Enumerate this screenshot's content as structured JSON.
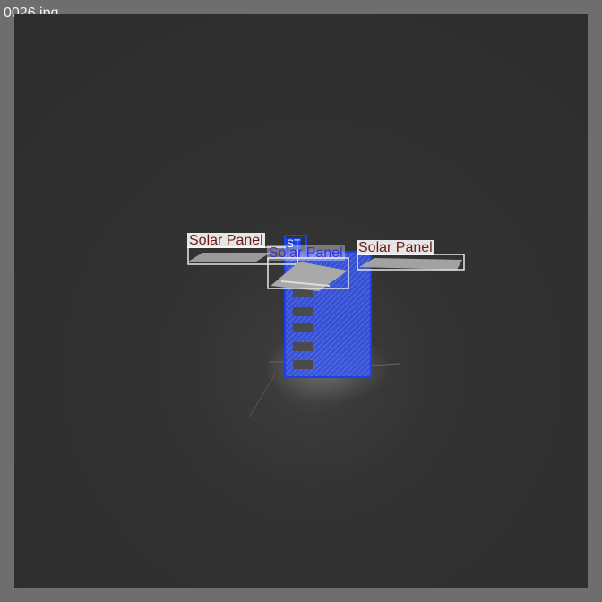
{
  "window": {
    "filename": "0026.jpg"
  },
  "detections": {
    "panel_left_label": "Solar Panel",
    "panel_center_label": "Solar Panel",
    "panel_right_label": "Solar Panel",
    "body_tag_label": "ST"
  },
  "colors": {
    "frame": "#6e6e6e",
    "background": "#303030",
    "body_box": "#1f3fe8",
    "panel_box": "#e6e6e6",
    "label_text": "#6b1c12"
  }
}
